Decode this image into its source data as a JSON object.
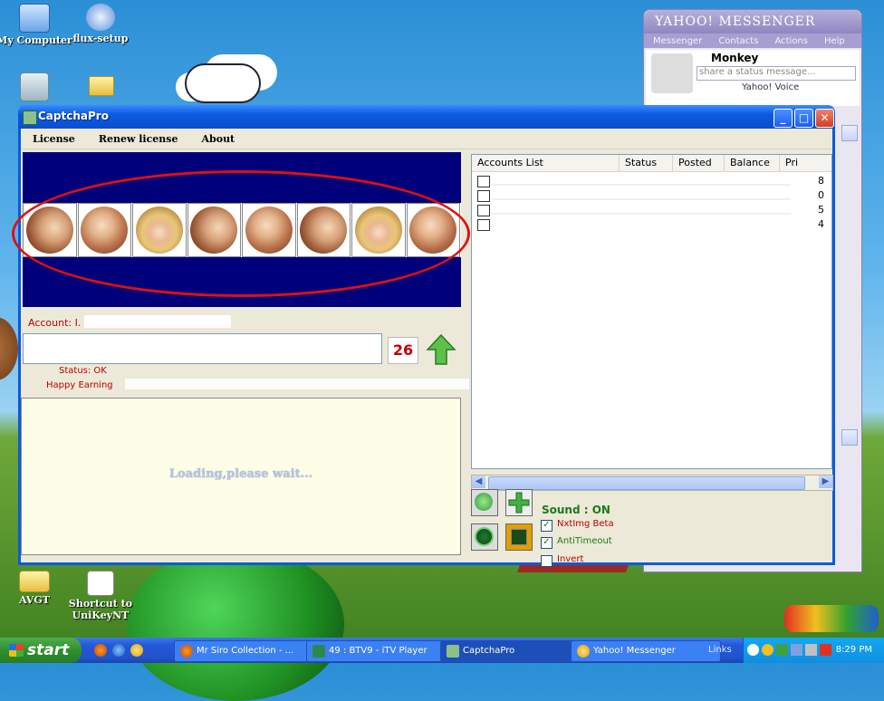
{
  "desktop": {
    "icons": [
      {
        "label": "My Computer"
      },
      {
        "label": "flux-setup"
      },
      {
        "label": "AVGT"
      },
      {
        "label": "Shortcut to UniKeyNT"
      }
    ]
  },
  "yahoo": {
    "title": "YAHOO! MESSENGER",
    "menu": [
      "Messenger",
      "Contacts",
      "Actions",
      "Help"
    ],
    "user_name": "Monkey",
    "status_placeholder": "share a status message...",
    "voice_label": "Yahoo! Voice"
  },
  "window": {
    "title": "CaptchaPro",
    "menu": [
      "License",
      "Renew license",
      "About"
    ],
    "captcha_images": 8,
    "account_label": "Account: I.",
    "counter": "26",
    "status_text": "Status: OK",
    "happy_text": "Happy Earning",
    "loading_text": "Loading,please wait...",
    "accounts": {
      "columns": [
        "Accounts List",
        "Status",
        "Posted",
        "Balance",
        "Pri"
      ],
      "rows": [
        {
          "pri": "8"
        },
        {
          "pri": "0"
        },
        {
          "pri": "5"
        },
        {
          "pri": "4"
        }
      ]
    },
    "options": {
      "sound_label": "Sound : ON",
      "nxtimg_label": "NxtImg Beta",
      "nxtimg_checked": true,
      "antitimeout_label": "AntiTimeout",
      "antitimeout_checked": true,
      "invert_label": "Invert",
      "invert_checked": false
    }
  },
  "taskbar": {
    "start_label": "start",
    "tasks": [
      {
        "label": "Mr Siro Collection - ..."
      },
      {
        "label": "49 : BTV9 - iTV Player"
      },
      {
        "label": "CaptchaPro"
      },
      {
        "label": "Yahoo! Messenger"
      }
    ],
    "links_label": "Links",
    "clock": "8:29 PM"
  },
  "colors": {
    "title_bar": "#0a5ae0",
    "captcha_bg": "#00007a",
    "highlight_ellipse": "#e01010",
    "status_red": "#c00000",
    "sound_green": "#1a7a1a"
  }
}
